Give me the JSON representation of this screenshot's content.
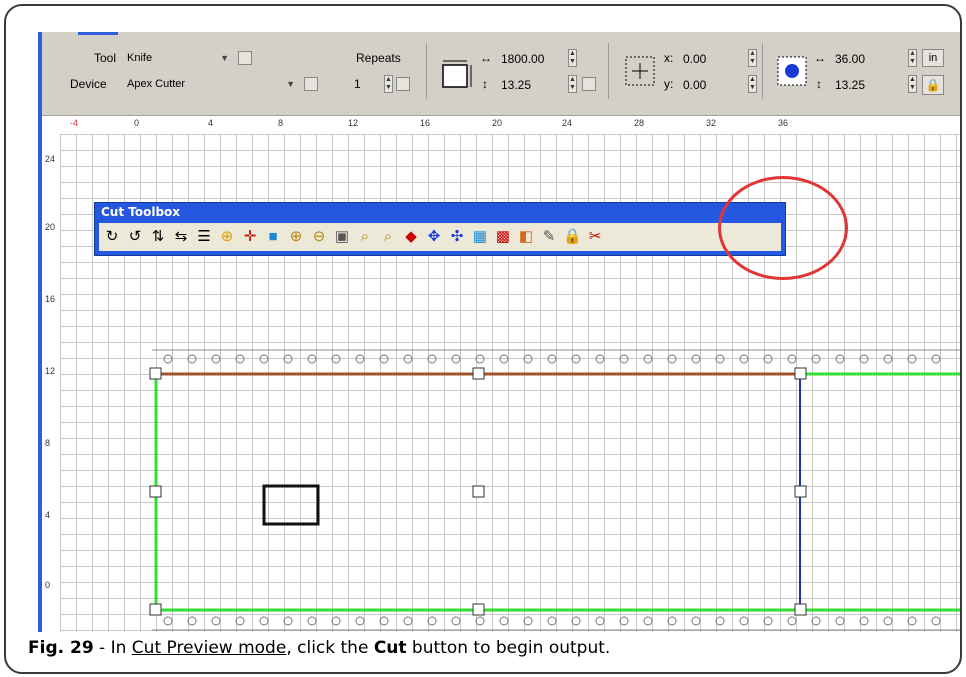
{
  "toolbar": {
    "tool_label": "Tool",
    "tool_value": "Knife",
    "device_label": "Device",
    "device_value": "Apex Cutter",
    "repeats_label": "Repeats",
    "repeats_value": "1",
    "width_value": "1800.00",
    "height_value": "13.25",
    "x_label": "x:",
    "x_value": "0.00",
    "y_label": "y:",
    "y_value": "0.00",
    "width2_value": "36.00",
    "height2_value": "13.25",
    "units_label": "in"
  },
  "ruler": {
    "horizontal_ticks": [
      "-4",
      "0",
      "4",
      "8",
      "12",
      "16",
      "20",
      "24",
      "28",
      "32",
      "36"
    ],
    "vertical_ticks": [
      "24",
      "20",
      "16",
      "12",
      "8",
      "4",
      "0"
    ]
  },
  "cut_toolbox": {
    "title": "Cut Toolbox",
    "icons": [
      "rotate-cw-icon",
      "rotate-ccw-icon",
      "mirror-vertical-icon",
      "mirror-horizontal-icon",
      "align-icon",
      "target-icon",
      "crosshair-icon",
      "fill-icon",
      "zoom-in-icon",
      "zoom-out-icon",
      "zoom-fit-icon",
      "zoom-window-icon",
      "zoom-page-icon",
      "weed-icon",
      "move-icon",
      "jog-icon",
      "select-icon",
      "tile-icon",
      "color-icon",
      "tool-icon",
      "lock-icon",
      "cut-icon"
    ]
  },
  "caption": {
    "fig": "Fig. 29",
    "t1": " - In ",
    "mode": "Cut Preview mode",
    "t2": ", click the ",
    "button": "Cut",
    "t3": " button to begin output."
  },
  "colors": {
    "accent_blue": "#2458e0",
    "highlight_red": "#e23535",
    "path_green": "#33dd33",
    "path_brown": "#a0522d",
    "path_navy": "#2233aa"
  }
}
